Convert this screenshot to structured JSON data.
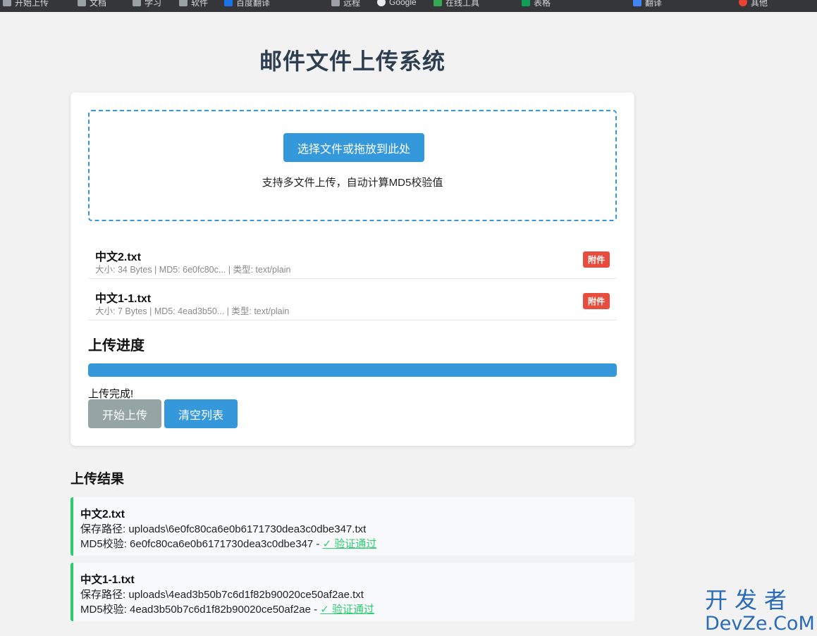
{
  "browser": {
    "bookmarks": [
      {
        "label": "开始上传",
        "icon_color": "#9aa0a6"
      },
      {
        "label": "文档",
        "icon_color": "#9aa0a6"
      },
      {
        "label": "学习",
        "icon_color": "#9aa0a6"
      },
      {
        "label": "软件",
        "icon_color": "#9aa0a6"
      },
      {
        "label": "百度翻译",
        "icon_color": "#1a73e8"
      },
      {
        "label": "远程",
        "icon_color": "#9aa0a6"
      },
      {
        "label": "Google",
        "icon_color": "#e8eaed"
      },
      {
        "label": "在线工具",
        "icon_color": "#34a853"
      },
      {
        "label": "表格",
        "icon_color": "#0f9d58"
      },
      {
        "label": "翻译",
        "icon_color": "#4285f4"
      },
      {
        "label": "其他",
        "icon_color": "#ea4335"
      }
    ]
  },
  "page": {
    "title": "邮件文件上传系统"
  },
  "upload": {
    "select_button": "选择文件或拖放到此处",
    "hint": "支持多文件上传，自动计算MD5校验值",
    "files": [
      {
        "name": "中文2.txt",
        "meta": "大小: 34 Bytes | MD5: 6e0fc80c... | 类型: text/plain",
        "badge": "附件"
      },
      {
        "name": "中文1-1.txt",
        "meta": "大小: 7 Bytes | MD5: 4ead3b50... | 类型: text/plain",
        "badge": "附件"
      }
    ],
    "progress_title": "上传进度",
    "progress_percent": 100,
    "status": "上传完成!",
    "start_button": "开始上传",
    "clear_button": "清空列表"
  },
  "results": {
    "title": "上传结果",
    "items": [
      {
        "name": "中文2.txt",
        "path": "保存路径: uploads\\6e0fc80ca6e0b6171730dea3c0dbe347.txt",
        "md5": "MD5校验: 6e0fc80ca6e0b6171730dea3c0dbe347 - ",
        "verify": "✓ 验证通过"
      },
      {
        "name": "中文1-1.txt",
        "path": "保存路径: uploads\\4ead3b50b7c6d1f82b90020ce50af2ae.txt",
        "md5": "MD5校验: 4ead3b50b7c6d1f82b90020ce50af2ae - ",
        "verify": "✓ 验证通过"
      }
    ]
  },
  "watermark": {
    "cn": "开发者",
    "en": "DevZe.CoM"
  },
  "colors": {
    "accent": "#3498db",
    "success": "#2ecc71",
    "badge": "#e74c3c",
    "disabled": "#95a5a6",
    "title": "#2c3e50"
  }
}
